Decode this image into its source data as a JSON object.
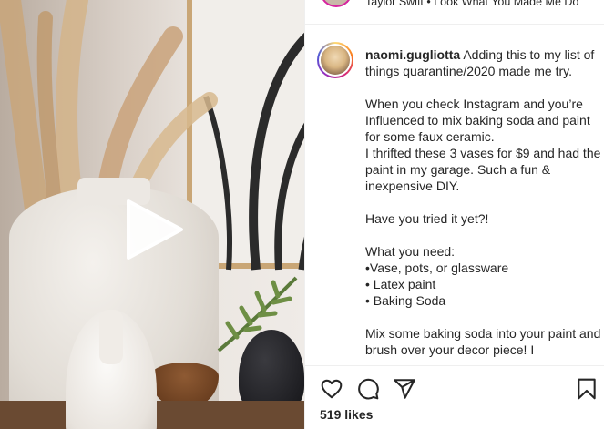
{
  "previous_post": {
    "caption": "Taylor Swift • Look What You Made Me Do"
  },
  "comment": {
    "username": "naomi.gugliotta",
    "text": " Adding this to my list of things quarantine/2020 made me try.\n\nWhen you check Instagram and you’re Influenced to mix baking soda and paint for some faux ceramic.\nI thrifted these 3 vases for $9 and had the paint in my garage. Such a fun & inexpensive DIY.\n\nHave you tried it yet?!\n\nWhat you need:\n•Vase, pots, or glassware\n• Latex paint\n• Baking Soda\n\nMix some baking soda into your paint and brush over your decor piece! I"
  },
  "media": {
    "play_icon": "play-icon"
  },
  "actions": {
    "icons": [
      "heart-icon",
      "comment-icon",
      "share-icon",
      "bookmark-icon"
    ],
    "likes": "519 likes"
  },
  "colors": {
    "text": "#262626",
    "divider": "#efefef",
    "story_ring": [
      "#feda75",
      "#fa7e1e",
      "#d62976",
      "#962fbf",
      "#4f5bd5"
    ]
  }
}
